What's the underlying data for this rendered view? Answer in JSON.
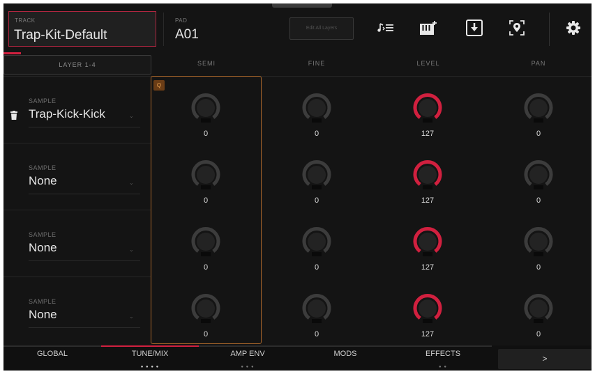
{
  "header": {
    "track_label": "TRACK",
    "track_name": "Trap-Kit-Default",
    "pad_label": "PAD",
    "pad_name": "A01",
    "edit_all_label": "Edit All Layers",
    "icons": [
      "note-list-icon",
      "keyboard-plus-icon",
      "download-icon",
      "location-pin-icon",
      "gear-icon"
    ]
  },
  "columns": {
    "layer_tab": "LAYER 1-4",
    "semi": "SEMI",
    "fine": "FINE",
    "level": "LEVEL",
    "pan": "PAN"
  },
  "q_badge": "Q",
  "rows": [
    {
      "sample_label": "SAMPLE",
      "sample_name": "Trap-Kick-Kick",
      "semi": "0",
      "fine": "0",
      "level": "127",
      "pan": "0"
    },
    {
      "sample_label": "SAMPLE",
      "sample_name": "None",
      "semi": "0",
      "fine": "0",
      "level": "127",
      "pan": "0"
    },
    {
      "sample_label": "SAMPLE",
      "sample_name": "None",
      "semi": "0",
      "fine": "0",
      "level": "127",
      "pan": "0"
    },
    {
      "sample_label": "SAMPLE",
      "sample_name": "None",
      "semi": "0",
      "fine": "0",
      "level": "127",
      "pan": "0"
    }
  ],
  "bottom_tabs": [
    {
      "label": "GLOBAL",
      "active": false
    },
    {
      "label": "TUNE/MIX",
      "active": true
    },
    {
      "label": "AMP ENV",
      "active": false
    },
    {
      "label": "MODS",
      "active": false
    },
    {
      "label": "EFFECTS",
      "active": false
    }
  ],
  "next_label": ">",
  "colors": {
    "accent": "#d1203f",
    "frame": "#a9662a",
    "background": "#141414"
  }
}
